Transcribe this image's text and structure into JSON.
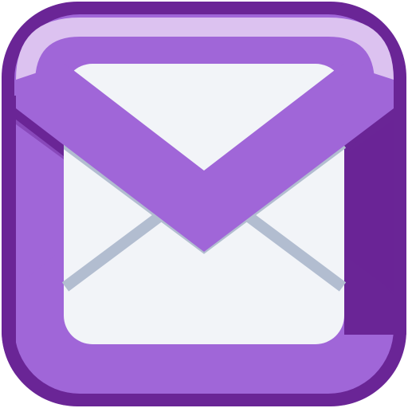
{
  "app_icon": {
    "icon": "mail-envelope-icon",
    "colors": {
      "frame_outer": "#6a2596",
      "frame_body": "#a066d8",
      "frame_highlight": "#dcc2f0",
      "frame_shadow": "#6a2596",
      "paper": "#f2f4f8",
      "fold_lines": "#b2bdd0",
      "background": "#ffffff"
    }
  }
}
